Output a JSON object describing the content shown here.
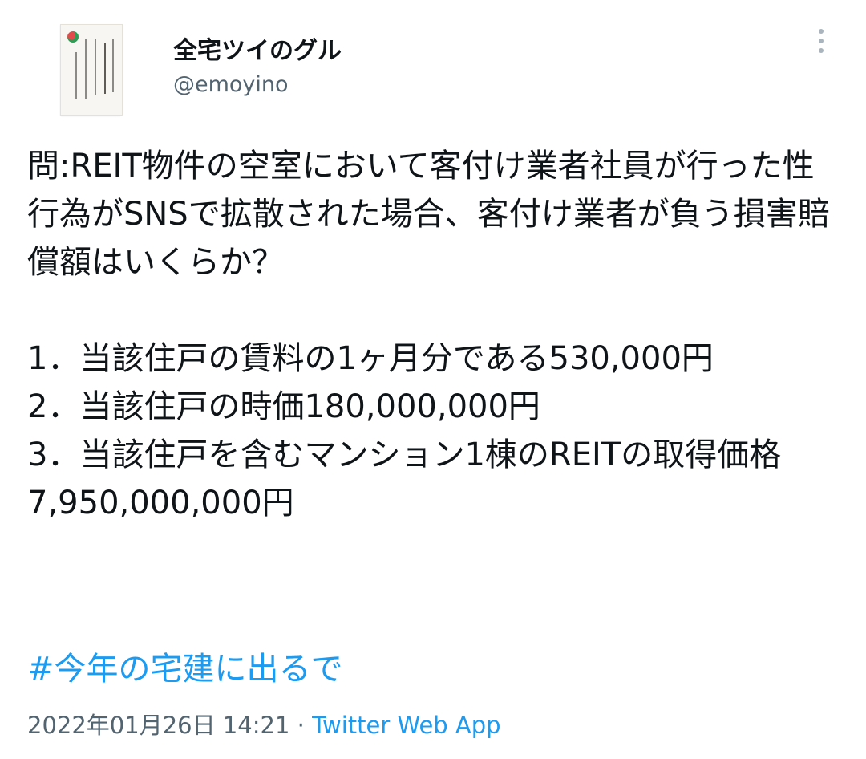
{
  "author": {
    "display_name": "全宅ツイのグル",
    "handle": "@emoyino",
    "avatar_icon": "book-cover-avatar-icon"
  },
  "tweet": {
    "text": "問:REIT物件の空室において客付け業者社員が行った性行為がSNSで拡散された場合、客付け業者が負う損害賠償額はいくらか？\n\n1．当該住戸の賃料の1ヶ月分である530,000円\n2．当該住戸の時価180,000,000円\n3．当該住戸を含むマンション1棟のREITの取得価格7,950,000,000円",
    "hashtag": "#今年の宅建に出るで",
    "timestamp": "2022年01月26日 14:21",
    "separator": " · ",
    "source": "Twitter Web App"
  },
  "icons": {
    "more": "more-vertical-icon"
  },
  "colors": {
    "text": "#0f1419",
    "secondary": "#536471",
    "link": "#1d9bf0",
    "background": "#ffffff"
  }
}
